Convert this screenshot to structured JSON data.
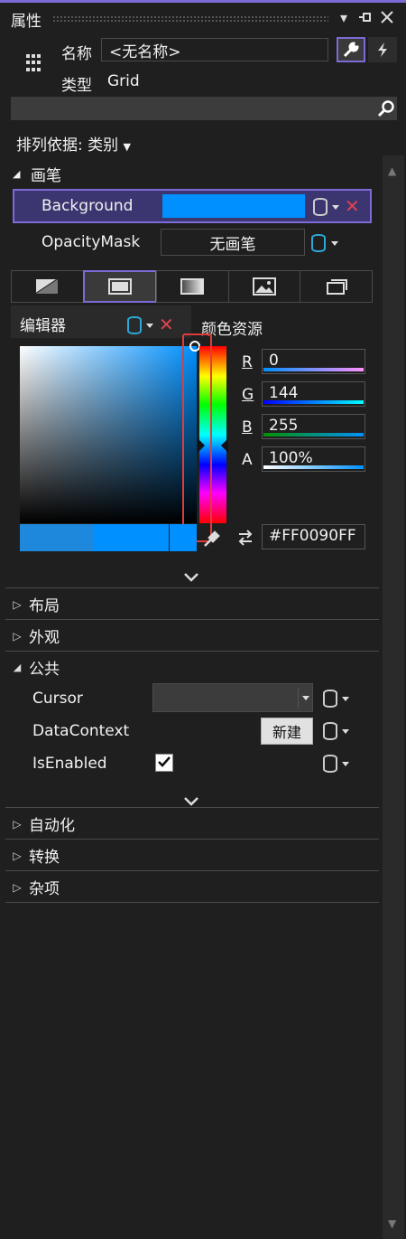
{
  "window": {
    "title": "属性"
  },
  "object": {
    "name_label": "名称",
    "name_value": "<无名称>",
    "type_label": "类型",
    "type_value": "Grid"
  },
  "sort": {
    "label": "排列依据: 类别"
  },
  "brush_section": {
    "title": "画笔",
    "background_label": "Background",
    "background_color": "#0090FF",
    "opacity_label": "OpacityMask",
    "opacity_value": "无画笔"
  },
  "editor": {
    "title": "编辑器",
    "resources": "颜色资源",
    "R_label": "R",
    "R": "0",
    "G_label": "G",
    "G": "144",
    "B_label": "B",
    "B": "255",
    "A_label": "A",
    "A": "100%",
    "hex": "#FF0090FF"
  },
  "sections": {
    "layout": "布局",
    "appearance": "外观",
    "common": "公共",
    "automation": "自动化",
    "transform": "转换",
    "misc": "杂项"
  },
  "common": {
    "cursor_label": "Cursor",
    "datacontext_label": "DataContext",
    "new_button": "新建",
    "isenabled_label": "IsEnabled",
    "isenabled_checked": true
  },
  "colors": {
    "accent": "#7C6BD6",
    "swatch": "#0090FF",
    "highlight": "#E23B3B"
  }
}
